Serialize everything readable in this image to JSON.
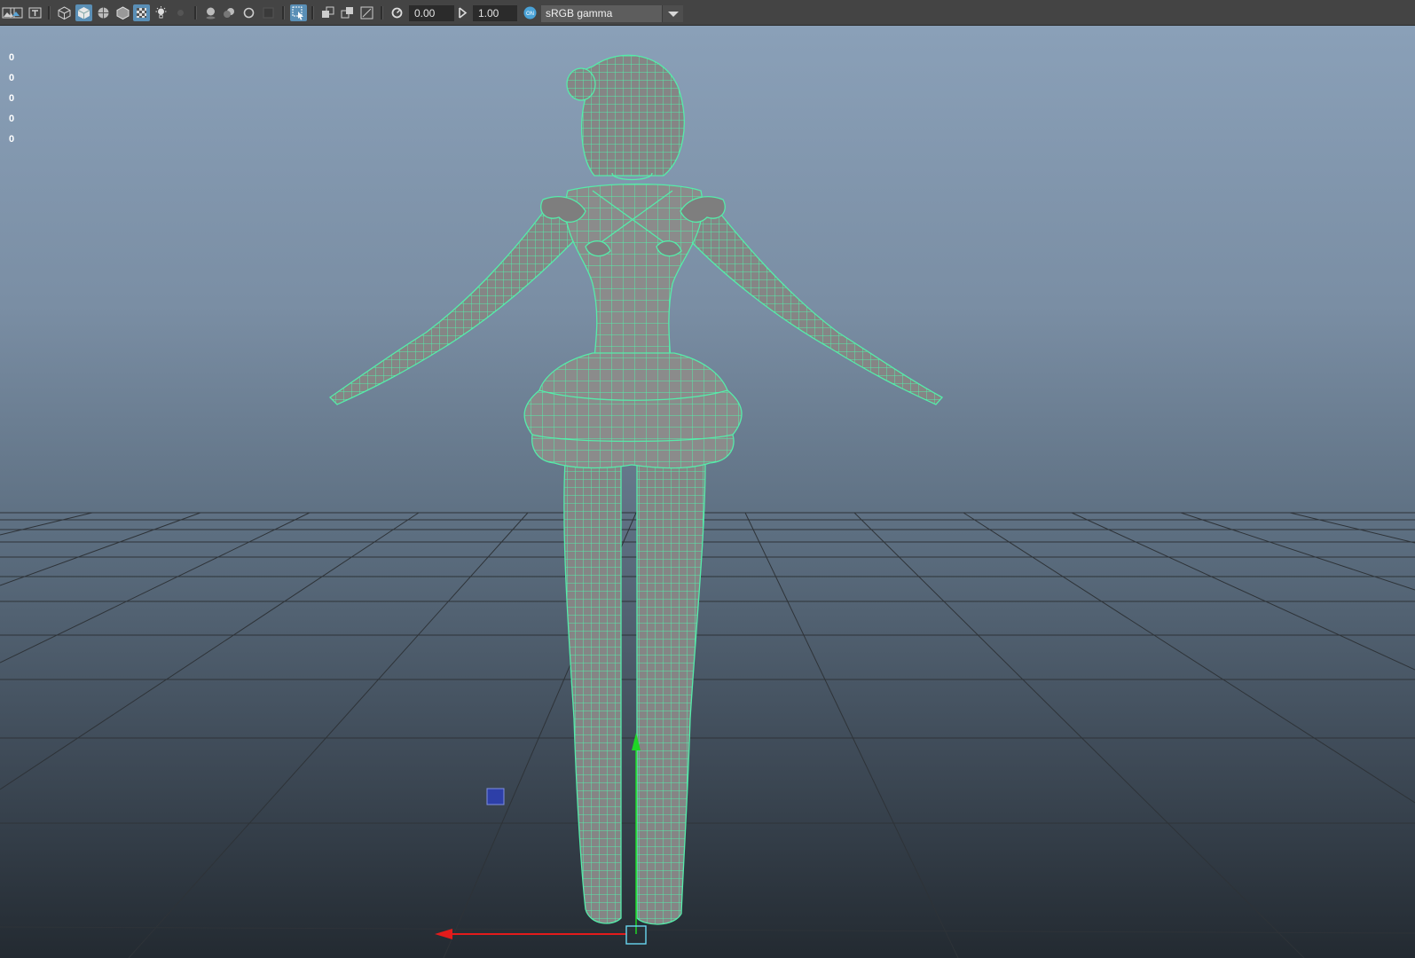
{
  "toolbar": {
    "exposure_value": "0.00",
    "gamma_value": "1.00",
    "color_space": "sRGB gamma",
    "icons": [
      "image-plane-icon",
      "camera-attributes-icon",
      "text-icon",
      "wireframe-icon",
      "smooth-shade-icon",
      "shaded-wireframe-icon",
      "default-material-icon",
      "textured-icon",
      "lights-icon",
      "shadows-icon",
      "ambient-occlusion-icon",
      "motion-blur-icon",
      "multisample-icon",
      "depth-of-field-icon",
      "isolate-select-icon",
      "xray-icon",
      "xray-joints-icon",
      "xray-components-icon",
      "exposure-icon",
      "gamma-icon",
      "color-management-icon"
    ]
  },
  "hud": {
    "values": [
      "0",
      "0",
      "0",
      "0",
      "0"
    ]
  },
  "colors": {
    "wire": "#55ecaa",
    "mesh": "#8a8a8a",
    "grid": "#2e3338",
    "x_axis": "#e31b1b",
    "y_axis": "#1fd626",
    "toolbar_bg": "#444444",
    "active": "#5a8fb6"
  }
}
